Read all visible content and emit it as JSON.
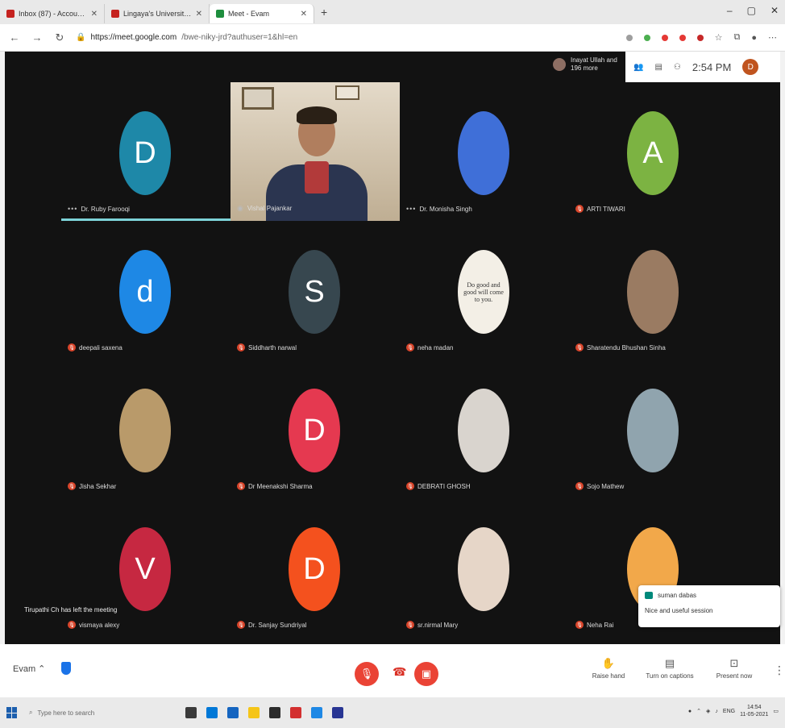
{
  "browser": {
    "tabs": [
      {
        "label": "Inbox (87) - Account@",
        "color": "#c5221f"
      },
      {
        "label": "Lingaya's University Mail",
        "color": "#c5221f"
      },
      {
        "label": "Meet - Evam",
        "color": "#1e8e3e"
      }
    ],
    "url_host": "https://meet.google.com",
    "url_path": "/bwe-niky-jrd?authuser=1&hl=en"
  },
  "meet": {
    "joined_text": "Inayat Ullah and 196 more",
    "clock": "2:54 PM",
    "my_avatar": "D",
    "participants": [
      {
        "name": "Dr. Ruby Farooqi",
        "initial": "D",
        "color": "#1e88a8",
        "speaking": true
      },
      {
        "name": "Vishal Pajankar",
        "initial": "",
        "color": "",
        "video": true
      },
      {
        "name": "Dr. Monisha Singh",
        "initial": "",
        "color": "#3f6fd8"
      },
      {
        "name": "ARTI TIWARI",
        "initial": "A",
        "color": "#7cb342"
      },
      {
        "name": "deepali saxena",
        "initial": "d",
        "color": "#1e88e5"
      },
      {
        "name": "Siddharth narwal",
        "initial": "S",
        "color": "#37474f"
      },
      {
        "name": "neha madan",
        "initial": "",
        "color": "#f3efe6",
        "quote": "Do good and good will come to you."
      },
      {
        "name": "Sharatendu Bhushan Sinha",
        "initial": "",
        "color": "#9a7b62"
      },
      {
        "name": "Jisha Sekhar",
        "initial": "",
        "color": "#b99a6a"
      },
      {
        "name": "Dr Meenakshi Sharma",
        "initial": "D",
        "color": "#e53950"
      },
      {
        "name": "DEBRATI GHOSH",
        "initial": "",
        "color": "#d9d4ce"
      },
      {
        "name": "Sojo Mathew",
        "initial": "",
        "color": "#90a4ae"
      },
      {
        "name": "vismaya alexy",
        "initial": "V",
        "color": "#c62841"
      },
      {
        "name": "Dr. Sanjay Sundriyal",
        "initial": "D",
        "color": "#f4511e"
      },
      {
        "name": "sr.nirmal Mary",
        "initial": "",
        "color": "#e6d6c8"
      },
      {
        "name": "Neha Rai",
        "initial": "",
        "color": "#f2a84a"
      }
    ],
    "left_notification": "Tirupathi Ch has left the meeting",
    "toast": {
      "sender": "suman dabas",
      "message": "Nice and useful session"
    }
  },
  "bottombar": {
    "meeting_name": "Evam",
    "raise_hand": "Raise hand",
    "captions": "Turn on captions",
    "present": "Present now"
  },
  "taskbar": {
    "search_placeholder": "Type here to search",
    "time": "14:54",
    "date": "11-05-2021",
    "lang": "ENG"
  }
}
